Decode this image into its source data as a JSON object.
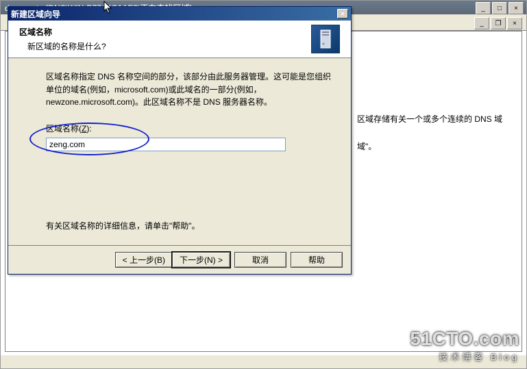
{
  "main_window": {
    "title": "dnsmgmt - [DNS\\WIN-B77A4G1AE3\\正向查找区域]",
    "controls": {
      "min": "_",
      "max": "□",
      "close": "×"
    }
  },
  "mdi": {
    "min": "_",
    "restore": "❐",
    "close": "×"
  },
  "background": {
    "line1": "区域存储有关一个或多个连续的 DNS 域",
    "line2": "域\"。"
  },
  "wizard": {
    "title": "新建区域向导",
    "close": "×",
    "header": {
      "title": "区域名称",
      "subtitle": "新区域的名称是什么?"
    },
    "body": {
      "description": "区域名称指定 DNS 名称空间的部分，该部分由此服务器管理。这可能是您组织单位的域名(例如，microsoft.com)或此域名的一部分(例如，newzone.microsoft.com)。此区域名称不是 DNS 服务器名称。",
      "field_label_pre": "区域名称(",
      "field_label_key": "Z",
      "field_label_post": "):",
      "input_value": "zeng.com",
      "help_line": "有关区域名称的详细信息，请单击\"帮助\"。"
    },
    "buttons": {
      "back": "< 上一步(B)",
      "next": "下一步(N) >",
      "cancel": "取消",
      "help": "帮助"
    }
  },
  "watermark": {
    "big": "51CTO.com",
    "small": "技术博客   Blog"
  }
}
